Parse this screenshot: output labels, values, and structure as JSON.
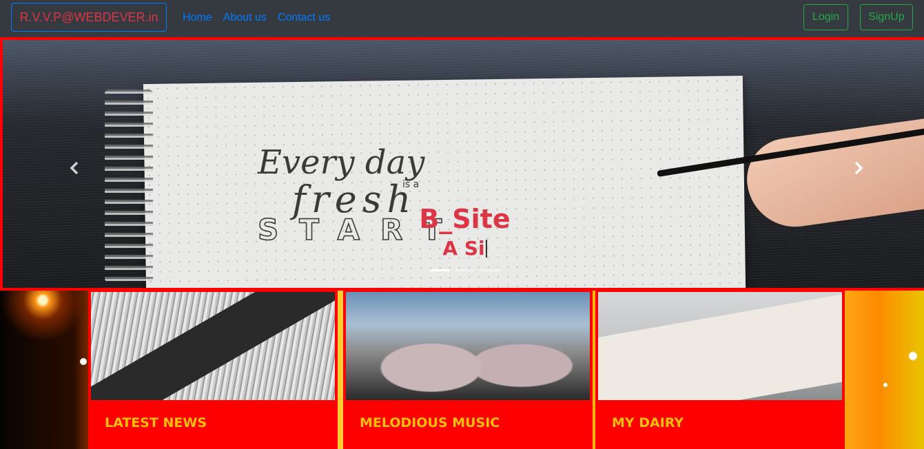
{
  "navbar": {
    "brand": "R.V.V.P@WEBDEVER.in",
    "links": [
      "Home",
      "About us",
      "Contact us"
    ],
    "login": "Login",
    "signup": "SignUp",
    "colors": {
      "background": "#343a40",
      "link": "#007bff",
      "brand_text": "#dc3545",
      "auth": "#28a745"
    }
  },
  "carousel": {
    "image_text": {
      "line1": "Every day",
      "line2": "is a",
      "line3": "fresh",
      "line4": "START"
    },
    "caption_title": "B_Site",
    "caption_sub": "A Si",
    "prev_icon": "chevron-left-icon",
    "next_icon": "chevron-right-icon",
    "indicator_count": 3,
    "active_indicator": 0,
    "colors": {
      "border": "#ff0000",
      "caption": "#dc3545"
    }
  },
  "cards": [
    {
      "title": "LATEST NEWS",
      "image": "newspaper-photo"
    },
    {
      "title": "MELODIOUS MUSIC",
      "image": "drum-kit-photo"
    },
    {
      "title": "MY DAIRY",
      "image": "notebook-glasses-photo"
    }
  ],
  "card_colors": {
    "background": "#ff0000",
    "title": "#ffc107"
  }
}
